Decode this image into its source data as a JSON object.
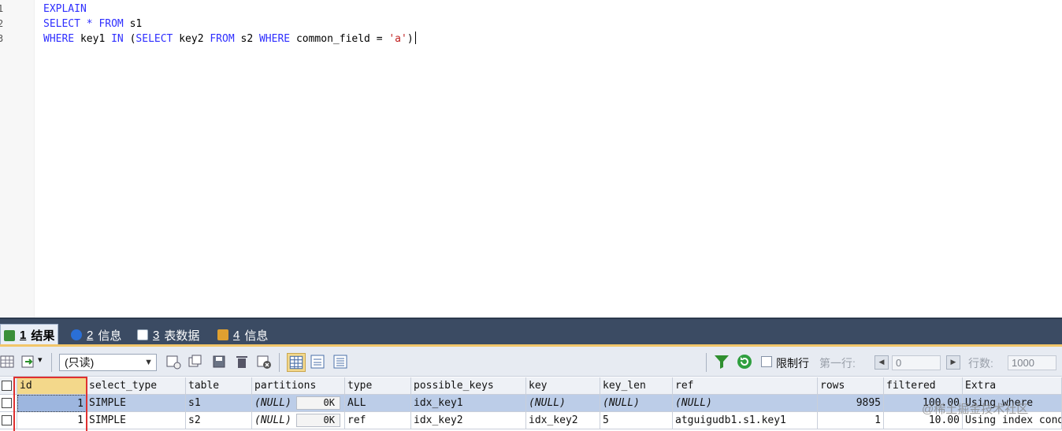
{
  "editor": {
    "line_numbers": [
      "1",
      "2",
      "3"
    ],
    "lines": [
      [
        {
          "t": "EXPLAIN",
          "k": "kw"
        }
      ],
      [
        {
          "t": "SELECT",
          "k": "kw"
        },
        {
          "t": " ",
          "k": ""
        },
        {
          "t": "*",
          "k": "kw"
        },
        {
          "t": " ",
          "k": ""
        },
        {
          "t": "FROM",
          "k": "kw"
        },
        {
          "t": " s1",
          "k": ""
        }
      ],
      [
        {
          "t": "WHERE",
          "k": "kw"
        },
        {
          "t": " key1 ",
          "k": ""
        },
        {
          "t": "IN",
          "k": "kw"
        },
        {
          "t": " (",
          "k": ""
        },
        {
          "t": "SELECT",
          "k": "kw"
        },
        {
          "t": " key2 ",
          "k": ""
        },
        {
          "t": "FROM",
          "k": "kw"
        },
        {
          "t": " s2 ",
          "k": ""
        },
        {
          "t": "WHERE",
          "k": "kw"
        },
        {
          "t": " common_field = ",
          "k": ""
        },
        {
          "t": "'a'",
          "k": "str"
        },
        {
          "t": ")",
          "k": ""
        }
      ]
    ]
  },
  "tabs": [
    {
      "num": "1",
      "label": "结果",
      "icon_color": "#3a8f3a"
    },
    {
      "num": "2",
      "label": "信息",
      "icon_color": "#2a6fd6"
    },
    {
      "num": "3",
      "label": "表数据",
      "icon_color": "#ffffff"
    },
    {
      "num": "4",
      "label": "信息",
      "icon_color": "#e0a030"
    }
  ],
  "toolbar": {
    "mode_select": "(只读)",
    "limit_rows_label": "限制行",
    "first_row_label": "第一行:",
    "first_row_value": "0",
    "row_count_label": "行数:",
    "row_count_value": "1000",
    "filter_icon_color": "#2f8f2f",
    "refresh_icon_color": "#2f9f3f"
  },
  "grid": {
    "columns": [
      "id",
      "select_type",
      "table",
      "partitions",
      "type",
      "possible_keys",
      "key",
      "key_len",
      "ref",
      "rows",
      "filtered",
      "Extra"
    ],
    "rows": [
      {
        "id": "1",
        "select_type": "SIMPLE",
        "table": "s1",
        "partitions": "(NULL)",
        "partitions_badge": "0K",
        "type": "ALL",
        "possible_keys": "idx_key1",
        "key": "(NULL)",
        "key_len": "(NULL)",
        "ref": "(NULL)",
        "rows": "9895",
        "filtered": "100.00",
        "Extra": "Using where"
      },
      {
        "id": "1",
        "select_type": "SIMPLE",
        "table": "s2",
        "partitions": "(NULL)",
        "partitions_badge": "0K",
        "type": "ref",
        "possible_keys": "idx_key2",
        "key": "idx_key2",
        "key_len": "5",
        "ref": "atguigudb1.s1.key1",
        "rows": "1",
        "filtered": "10.00",
        "Extra": "Using index condition; Using where"
      }
    ]
  },
  "watermark": "@稀土掘金技术社区"
}
